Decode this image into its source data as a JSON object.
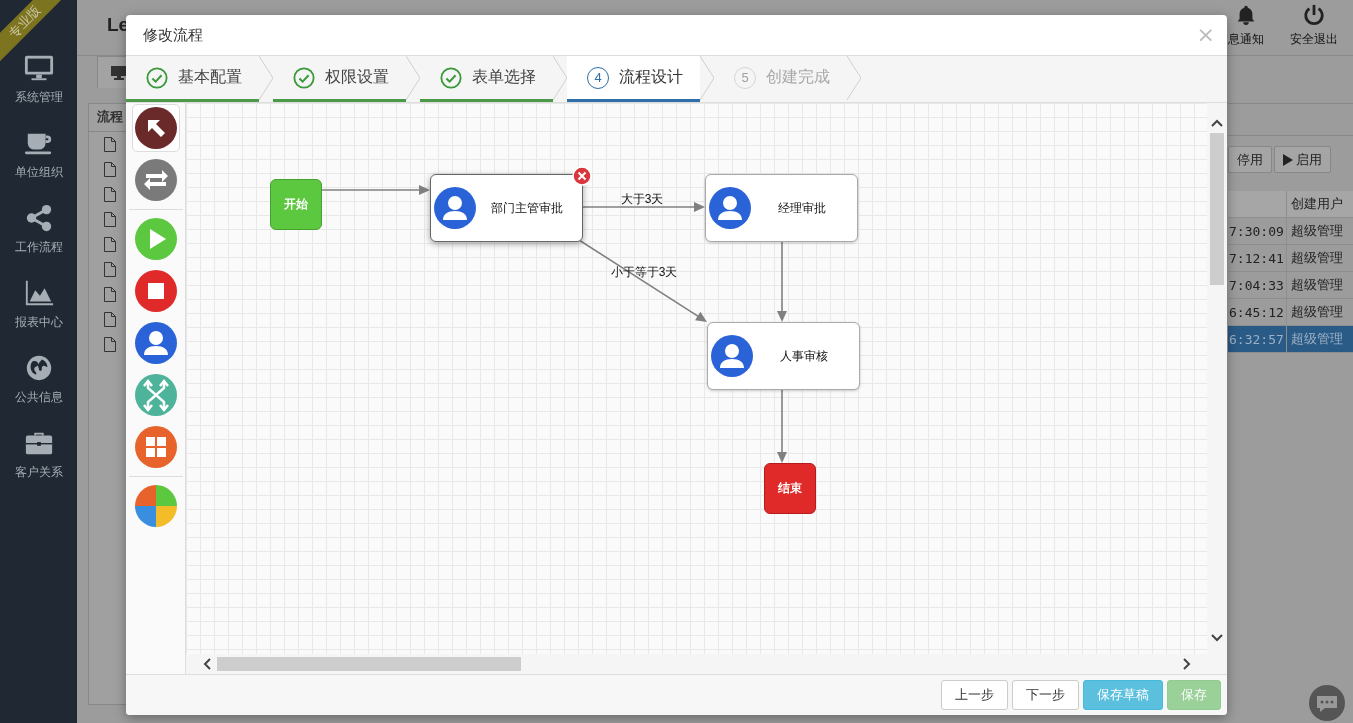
{
  "edition_ribbon": "专业版",
  "sidebar": {
    "items": [
      {
        "label": "系统管理",
        "kind": "monitor"
      },
      {
        "label": "单位组织",
        "kind": "cup"
      },
      {
        "label": "工作流程",
        "kind": "share"
      },
      {
        "label": "报表中心",
        "kind": "chart"
      },
      {
        "label": "公共信息",
        "kind": "globe"
      },
      {
        "label": "客户关系",
        "kind": "briefcase"
      }
    ]
  },
  "app_title": "Le",
  "header_actions": [
    {
      "label": "息通知",
      "kind": "bell"
    },
    {
      "label": "安全退出",
      "kind": "power"
    }
  ],
  "left_panel": {
    "title": "流程"
  },
  "right_toolbar": [
    {
      "label": "停用",
      "kind": "plain"
    },
    {
      "label": "启用",
      "kind": "play"
    }
  ],
  "table": {
    "columns": [
      "创建用户"
    ],
    "rows": [
      {
        "time": "7:30:09",
        "user": "超级管理",
        "selected": false
      },
      {
        "time": "7:12:41",
        "user": "超级管理",
        "selected": false
      },
      {
        "time": "7:04:33",
        "user": "超级管理",
        "selected": false
      },
      {
        "time": "6:45:12",
        "user": "超级管理",
        "selected": false
      },
      {
        "time": "6:32:57",
        "user": "超级管理",
        "selected": true
      }
    ]
  },
  "dialog": {
    "title": "修改流程",
    "close": "×",
    "steps": [
      {
        "label": "基本配置",
        "completed": true,
        "selected": false
      },
      {
        "label": "权限设置",
        "completed": true,
        "selected": false
      },
      {
        "label": "表单选择",
        "completed": true,
        "selected": false
      },
      {
        "number": "4",
        "label": "流程设计",
        "completed": false,
        "selected": true
      },
      {
        "number": "5",
        "label": "创建完成",
        "completed": false,
        "selected": false
      }
    ],
    "tools": [
      {
        "kind": "pointer",
        "selected": true
      },
      {
        "kind": "connect",
        "selected": false
      },
      {
        "kind": "start",
        "selected": false
      },
      {
        "kind": "end",
        "selected": false
      },
      {
        "kind": "task",
        "selected": false
      },
      {
        "kind": "fork",
        "selected": false
      },
      {
        "kind": "subprocess",
        "selected": false
      },
      {
        "kind": "chart",
        "selected": false
      }
    ],
    "nodes": [
      {
        "kind": "start",
        "label": "开始",
        "selected": false
      },
      {
        "kind": "task",
        "label": "部门主管审批",
        "selected": true
      },
      {
        "kind": "task",
        "label": "经理审批",
        "selected": false
      },
      {
        "kind": "task",
        "label": "人事审核",
        "selected": false
      },
      {
        "kind": "end",
        "label": "结束",
        "selected": false
      }
    ],
    "edge_labels": [
      "大于3天",
      "小于等于3天"
    ],
    "buttons": [
      {
        "label": "上一步",
        "kind": "default",
        "disabled": false
      },
      {
        "label": "下一步",
        "kind": "default",
        "disabled": false
      },
      {
        "label": "保存草稿",
        "kind": "info",
        "disabled": false
      },
      {
        "label": "保存",
        "kind": "success",
        "disabled": true
      }
    ]
  }
}
